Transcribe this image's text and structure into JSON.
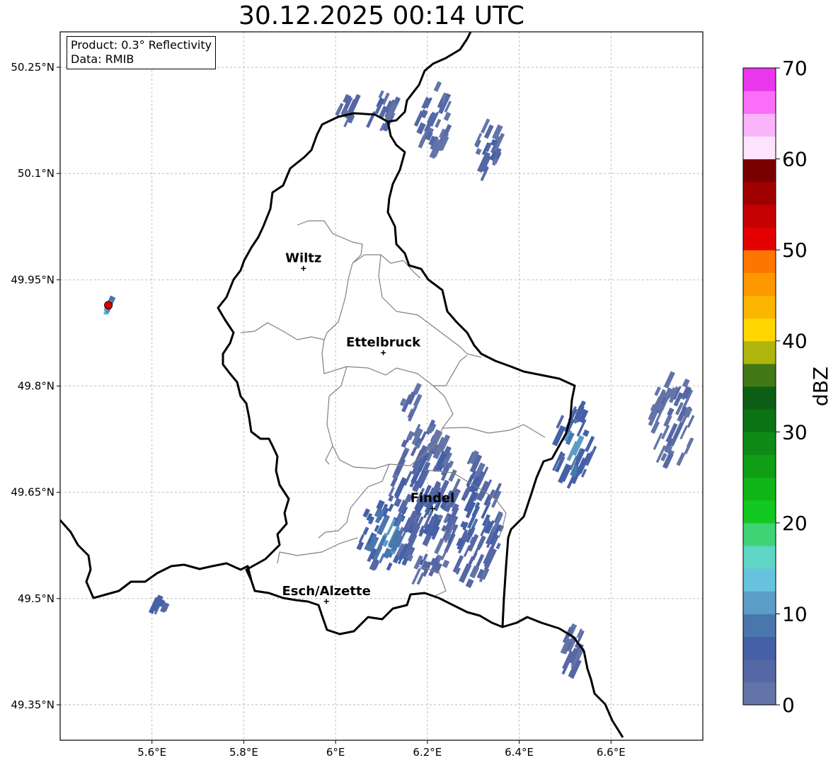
{
  "title": "30.12.2025 00:14 UTC",
  "info": {
    "product": "Product: 0.3° Reflectivity",
    "source": "Data: RMIB"
  },
  "axes": {
    "x_ticks": [
      {
        "lon": 5.6,
        "label": "5.6°E"
      },
      {
        "lon": 5.8,
        "label": "5.8°E"
      },
      {
        "lon": 6.0,
        "label": "6°E"
      },
      {
        "lon": 6.2,
        "label": "6.2°E"
      },
      {
        "lon": 6.4,
        "label": "6.4°E"
      },
      {
        "lon": 6.6,
        "label": "6.6°E"
      }
    ],
    "y_ticks": [
      {
        "lat": 50.25,
        "label": "50.25°N"
      },
      {
        "lat": 50.1,
        "label": "50.1°N"
      },
      {
        "lat": 49.95,
        "label": "49.95°N"
      },
      {
        "lat": 49.8,
        "label": "49.8°N"
      },
      {
        "lat": 49.65,
        "label": "49.65°N"
      },
      {
        "lat": 49.5,
        "label": "49.5°N"
      },
      {
        "lat": 49.35,
        "label": "49.35°N"
      }
    ],
    "extent": {
      "lon_min": 5.4,
      "lon_max": 6.8,
      "lat_min": 49.3,
      "lat_max": 50.3
    },
    "grid": true
  },
  "cities": [
    {
      "name": "Wiltz",
      "lon": 5.93,
      "lat": 49.966
    },
    {
      "name": "Ettelbruck",
      "lon": 6.104,
      "lat": 49.847
    },
    {
      "name": "Findel",
      "lon": 6.211,
      "lat": 49.627
    },
    {
      "name": "Esch/Alzette",
      "lon": 5.98,
      "lat": 49.496
    }
  ],
  "radar_site": {
    "lon": 5.505,
    "lat": 49.914,
    "color": "#e00000"
  },
  "colorbar": {
    "label": "dBZ",
    "min": 0,
    "max": 70,
    "step": 2.5,
    "tick_values": [
      0,
      10,
      20,
      30,
      40,
      50,
      60,
      70
    ],
    "tick_labels": [
      "0",
      "10",
      "20",
      "30",
      "40",
      "50",
      "60",
      "70"
    ],
    "colors": [
      "#6374a8",
      "#5567a5",
      "#4560a6",
      "#4a76ae",
      "#5b9dc6",
      "#67c2dd",
      "#5fd5c6",
      "#3ed476",
      "#13c820",
      "#10b617",
      "#0f9e16",
      "#0e8b16",
      "#0c7315",
      "#0c5f14",
      "#437816",
      "#aeb50c",
      "#ffd600",
      "#fcb500",
      "#fd9800",
      "#fd7700",
      "#e30000",
      "#c50000",
      "#a00000",
      "#7a0000",
      "#fde3fe",
      "#fbb3fb",
      "#fa6ef8",
      "#ea36ec"
    ]
  },
  "colors": {
    "country_border": "#000000",
    "canton_border": "#808080",
    "gridline": "#b0b0b0"
  },
  "echo_cells": [
    {
      "lon": 6.032,
      "lat": 50.195,
      "rx": 0.028,
      "ry": 0.022,
      "dbz": 5
    },
    {
      "lon": 6.098,
      "lat": 50.19,
      "rx": 0.032,
      "ry": 0.027,
      "dbz": 5
    },
    {
      "lon": 6.215,
      "lat": 50.178,
      "rx": 0.035,
      "ry": 0.055,
      "dbz": 4
    },
    {
      "lon": 6.335,
      "lat": 50.133,
      "rx": 0.035,
      "ry": 0.036,
      "dbz": 6
    },
    {
      "lon": 6.165,
      "lat": 49.783,
      "rx": 0.02,
      "ry": 0.025,
      "dbz": 4
    },
    {
      "lon": 6.195,
      "lat": 49.635,
      "rx": 0.075,
      "ry": 0.11,
      "dbz": 6
    },
    {
      "lon": 6.115,
      "lat": 49.59,
      "rx": 0.065,
      "ry": 0.05,
      "dbz": 12
    },
    {
      "lon": 6.3,
      "lat": 49.61,
      "rx": 0.06,
      "ry": 0.09,
      "dbz": 7
    },
    {
      "lon": 6.52,
      "lat": 49.715,
      "rx": 0.04,
      "ry": 0.055,
      "dbz": 12
    },
    {
      "lon": 6.735,
      "lat": 49.755,
      "rx": 0.045,
      "ry": 0.065,
      "dbz": 3
    },
    {
      "lon": 6.52,
      "lat": 49.43,
      "rx": 0.025,
      "ry": 0.04,
      "dbz": 4
    },
    {
      "lon": 5.617,
      "lat": 49.49,
      "rx": 0.015,
      "ry": 0.005,
      "dbz": 12
    },
    {
      "lon": 5.505,
      "lat": 49.912,
      "rx": 0.006,
      "ry": 0.005,
      "dbz": 17
    }
  ]
}
